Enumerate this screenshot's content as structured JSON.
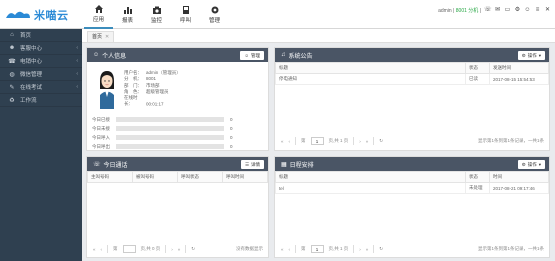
{
  "header": {
    "logo_text": "米喵云",
    "nav": [
      {
        "label": "应用",
        "icon": "home-icon"
      },
      {
        "label": "报表",
        "icon": "bar-chart-icon"
      },
      {
        "label": "监控",
        "icon": "camera-icon"
      },
      {
        "label": "呼叫",
        "icon": "phone-icon"
      },
      {
        "label": "管理",
        "icon": "gear-icon"
      }
    ],
    "user_text": "admin |",
    "ext_text": "8001 分机",
    "status_tail": "|"
  },
  "sidebar": {
    "items": [
      {
        "label": "首页",
        "icon": "home-icon"
      },
      {
        "label": "客服中心",
        "icon": "users-icon"
      },
      {
        "label": "电销中心",
        "icon": "phone-icon"
      },
      {
        "label": "微信管理",
        "icon": "wechat-icon"
      },
      {
        "label": "在线考试",
        "icon": "exam-icon"
      },
      {
        "label": "工作流",
        "icon": "workflow-icon"
      }
    ]
  },
  "tabs": {
    "home": "首页",
    "close": "✕"
  },
  "personal": {
    "title": "个人信息",
    "button": "管理",
    "rows": [
      {
        "k": "用户名：",
        "v": "admin（管理员）"
      },
      {
        "k": "分　机：",
        "v": "8001"
      },
      {
        "k": "部　门：",
        "v": "市场部"
      },
      {
        "k": "角　色：",
        "v": "超级管理员"
      },
      {
        "k": "在线时长：",
        "v": "00:01:17"
      }
    ],
    "progress": [
      {
        "label": "今日已接",
        "value": "0"
      },
      {
        "label": "今日未接",
        "value": "0"
      },
      {
        "label": "今日呼入",
        "value": "0"
      },
      {
        "label": "今日呼出",
        "value": "0"
      }
    ]
  },
  "notice": {
    "title": "系统公告",
    "button": "操作",
    "columns": [
      "标题",
      "状态",
      "发送时间"
    ],
    "rows": [
      {
        "title": "停电通知",
        "status": "已读",
        "time": "2017-08-15 15:54:53"
      }
    ],
    "pager": {
      "page": "1",
      "total": "页,共 1 页",
      "info": "显示第1条到第1条记录，一共1条"
    }
  },
  "calls": {
    "title": "今日通话",
    "button": "详情",
    "columns": [
      "主叫号码",
      "被叫号码",
      "呼叫状态",
      "呼叫时间"
    ],
    "pager": {
      "page": "第",
      "total": "页,共 0 页",
      "info": "没有数据显示"
    }
  },
  "schedule": {
    "title": "日程安排",
    "button": "操作",
    "columns": [
      "标题",
      "状态",
      "时间"
    ],
    "rows": [
      {
        "title": "tel",
        "status": "未处理",
        "time": "2017-08-21 09:17:46"
      }
    ],
    "pager": {
      "page": "1",
      "total": "页,共 1 页",
      "info": "显示第1条到第1条记录，一共1条"
    }
  },
  "colors": {
    "sidebar": "#2f4050",
    "panel_head": "#4a5565",
    "accent": "#3c8dbc"
  }
}
